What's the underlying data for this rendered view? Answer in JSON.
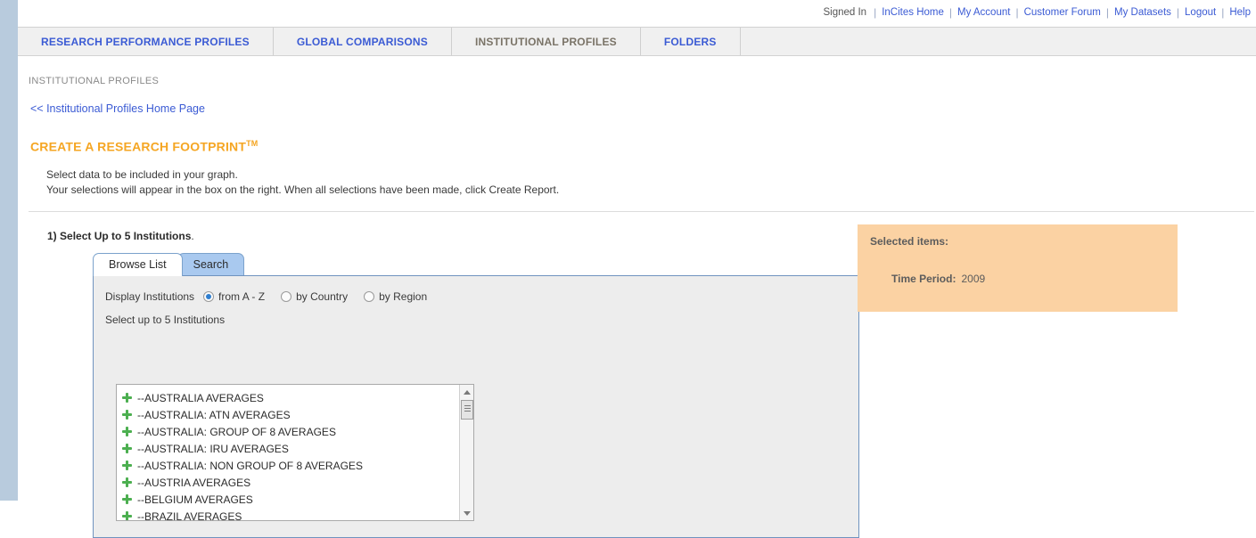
{
  "utility_bar": {
    "status": "Signed In",
    "links": [
      "InCites Home",
      "My Account",
      "Customer Forum",
      "My Datasets",
      "Logout",
      "Help"
    ]
  },
  "main_nav": {
    "tabs": [
      {
        "label": "RESEARCH PERFORMANCE PROFILES",
        "active": false
      },
      {
        "label": "GLOBAL COMPARISONS",
        "active": false
      },
      {
        "label": "INSTITUTIONAL PROFILES",
        "active": true
      },
      {
        "label": "FOLDERS",
        "active": false
      }
    ]
  },
  "page": {
    "breadcrumb": "INSTITUTIONAL PROFILES",
    "home_link": "<< Institutional Profiles Home Page",
    "title": "CREATE A RESEARCH FOOTPRINT",
    "title_tm": "TM",
    "instruction_line1": "Select data to be included in your graph.",
    "instruction_line2": "Your selections will appear in the box on the right. When all selections have been made, click Create Report.",
    "step1_number": "1)",
    "step1_text": "Select Up to 5 Institutions",
    "step1_period": "."
  },
  "sub_tabs": [
    {
      "label": "Browse List",
      "active": true
    },
    {
      "label": "Search",
      "active": false
    }
  ],
  "display_options": {
    "label": "Display Institutions",
    "options": [
      {
        "label": "from A - Z",
        "checked": true
      },
      {
        "label": "by Country",
        "checked": false
      },
      {
        "label": "by Region",
        "checked": false
      }
    ]
  },
  "list": {
    "hint": "Select up to 5 Institutions",
    "items": [
      "--AUSTRALIA AVERAGES",
      "--AUSTRALIA: ATN AVERAGES",
      "--AUSTRALIA: GROUP OF 8 AVERAGES",
      "--AUSTRALIA: IRU AVERAGES",
      "--AUSTRALIA: NON GROUP OF 8 AVERAGES",
      "--AUSTRIA AVERAGES",
      "--BELGIUM AVERAGES",
      "--BRAZIL AVERAGES"
    ]
  },
  "selected_panel": {
    "title": "Selected items:",
    "time_period_label": "Time Period:",
    "time_period_value": "2009"
  },
  "colors": {
    "accent_orange": "#f5a623",
    "link_blue": "#3b5bd4",
    "panel_peach": "#fbd2a3",
    "tab_active_blue": "#a9c9ef"
  }
}
